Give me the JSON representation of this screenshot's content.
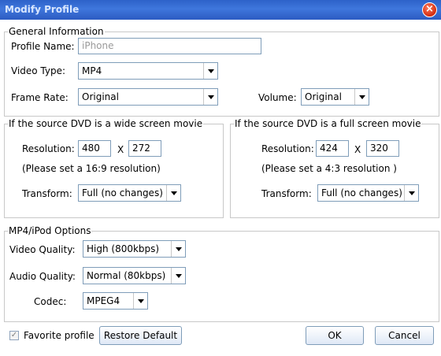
{
  "window": {
    "title": "Modify Profile",
    "close_glyph": "×"
  },
  "general": {
    "legend": "General Information",
    "profile_name_label": "Profile Name:",
    "profile_name_value": "iPhone",
    "video_type_label": "Video Type:",
    "video_type_value": "MP4",
    "frame_rate_label": "Frame Rate:",
    "frame_rate_value": "Original",
    "volume_label": "Volume:",
    "volume_value": "Original"
  },
  "wide": {
    "legend": "If the source DVD is a wide screen movie",
    "resolution_label": "Resolution:",
    "width": "480",
    "x_label": "X",
    "height": "272",
    "hint": "(Please set a 16:9 resolution)",
    "transform_label": "Transform:",
    "transform_value": "Full (no changes)"
  },
  "full": {
    "legend": "If the source DVD is a full screen movie",
    "resolution_label": "Resolution:",
    "width": "424",
    "x_label": "X",
    "height": "320",
    "hint": "(Please set a 4:3 resolution )",
    "transform_label": "Transform:",
    "transform_value": "Full (no changes)"
  },
  "mp4": {
    "legend": "MP4/iPod Options",
    "video_quality_label": "Video Quality:",
    "video_quality_value": "High (800kbps)",
    "audio_quality_label": "Audio Quality:",
    "audio_quality_value": "Normal (80kbps)",
    "codec_label": "Codec:",
    "codec_value": "MPEG4"
  },
  "footer": {
    "favorite_label": "Favorite profile",
    "favorite_checked": true,
    "restore_label": "Restore Default",
    "ok_label": "OK",
    "cancel_label": "Cancel"
  },
  "colors": {
    "titlebar": "#3a6fd8",
    "close": "#d22c10",
    "border": "#7f9db9"
  }
}
